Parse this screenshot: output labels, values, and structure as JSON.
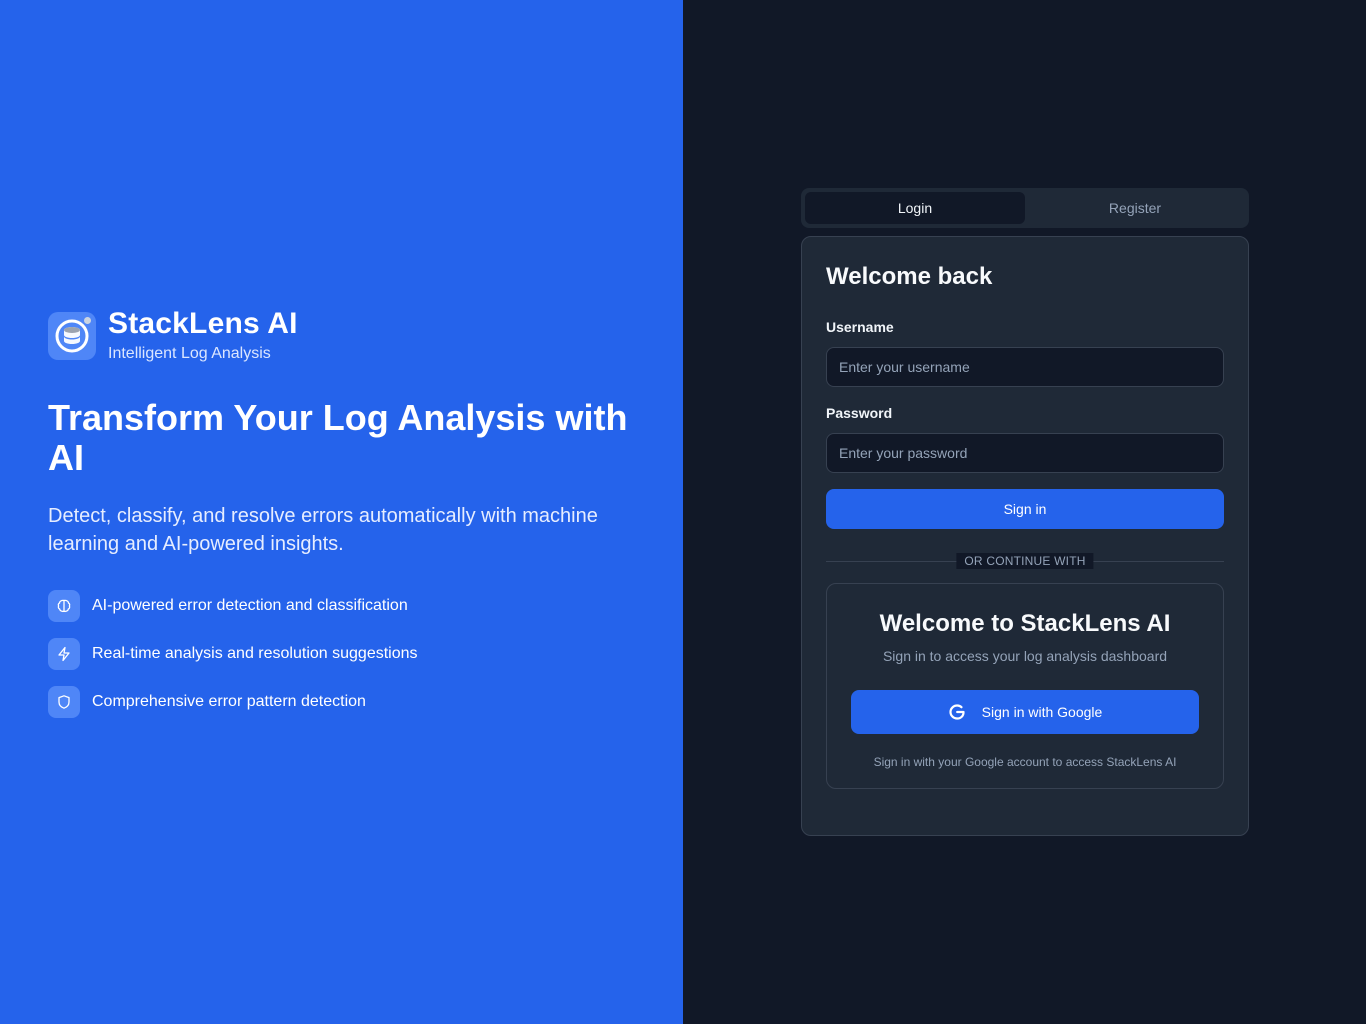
{
  "brand": {
    "name": "StackLens AI",
    "tagline": "Intelligent Log Analysis",
    "logo_icon": "database-stack-icon"
  },
  "hero": {
    "title": "Transform Your Log Analysis with AI",
    "description": "Detect, classify, and resolve errors automatically with machine learning and AI-powered insights.",
    "features": [
      {
        "icon": "brain-icon",
        "text": "AI-powered error detection and classification"
      },
      {
        "icon": "lightning-icon",
        "text": "Real-time analysis and resolution suggestions"
      },
      {
        "icon": "shield-icon",
        "text": "Comprehensive error pattern detection"
      }
    ]
  },
  "tabs": {
    "login": "Login",
    "register": "Register",
    "active": "login"
  },
  "login_form": {
    "title": "Welcome back",
    "username_label": "Username",
    "username_placeholder": "Enter your username",
    "username_value": "",
    "password_label": "Password",
    "password_placeholder": "Enter your password",
    "password_value": "",
    "submit_label": "Sign in",
    "divider_text": "OR CONTINUE WITH"
  },
  "sso": {
    "title": "Welcome to StackLens AI",
    "subtitle": "Sign in to access your log analysis dashboard",
    "google_button_label": "Sign in with Google",
    "google_icon": "google-icon",
    "note": "Sign in with your Google account to access StackLens AI"
  },
  "colors": {
    "brand_blue": "#2563eb",
    "dark_bg": "#111827",
    "card_bg": "#1f2937",
    "border": "#374151"
  }
}
